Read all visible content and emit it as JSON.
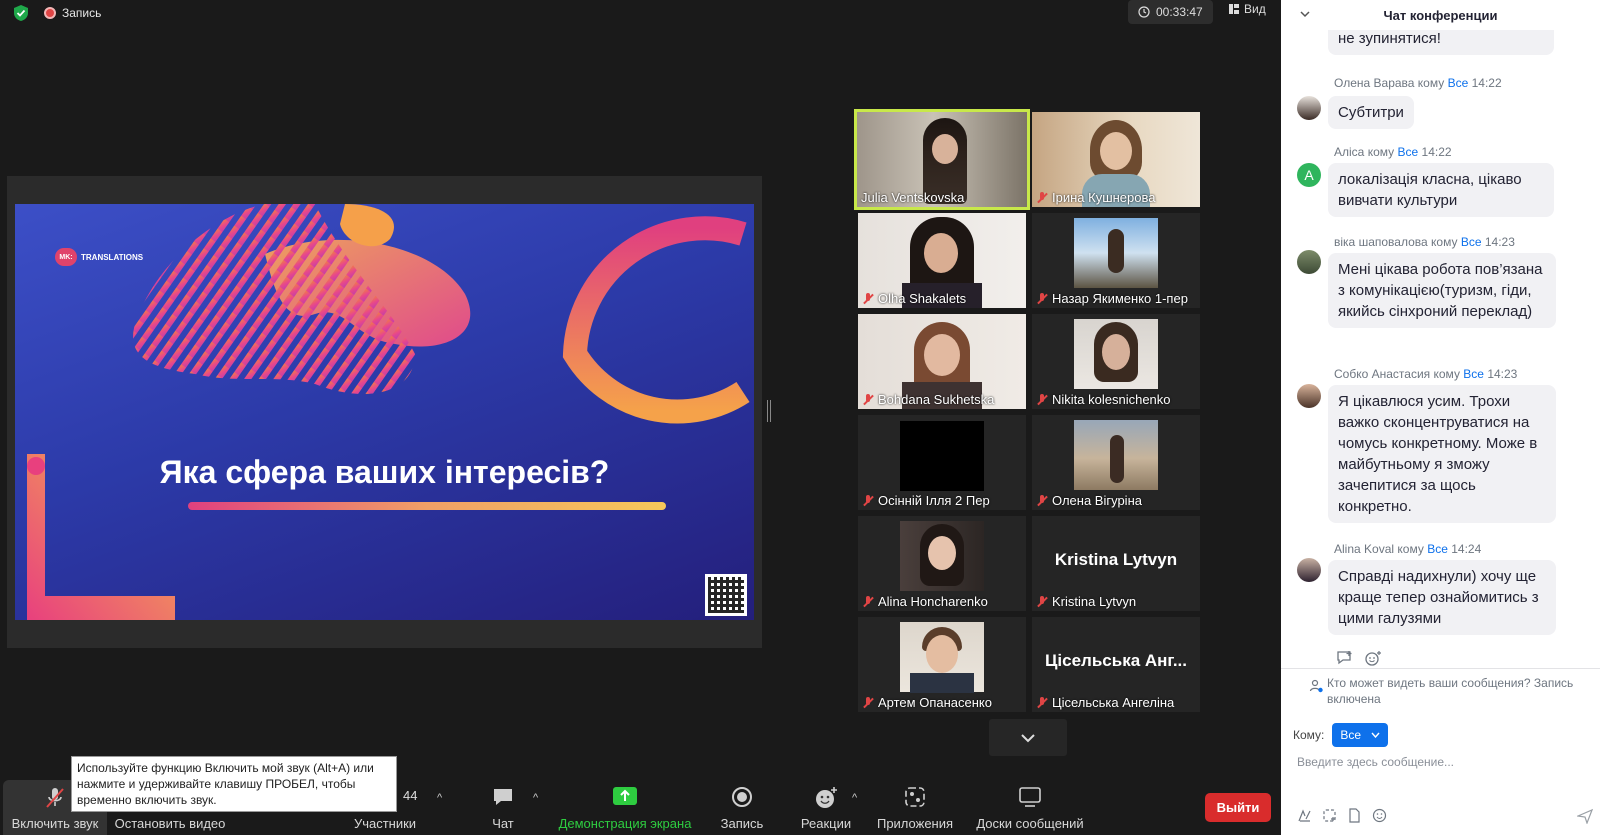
{
  "topbar": {
    "recording_label": "Запись",
    "timer": "00:33:47",
    "view_label": "Вид"
  },
  "slide": {
    "logo_mark": "MK:",
    "logo_text": "TRANSLATIONS",
    "question": "Яка сфера ваших інтересів?"
  },
  "gallery": {
    "tiles": [
      {
        "name": "Julia Ventskovska"
      },
      {
        "name": "Ірина Кушнерова"
      },
      {
        "name": "Olha Shakalets"
      },
      {
        "name": "Назар Якименко 1-пер"
      },
      {
        "name": "Bohdana Sukhetska"
      },
      {
        "name": "Nikita kolesnichenko"
      },
      {
        "name": "Осінній Ілля 2 Пер"
      },
      {
        "name": "Олена Вігуріна"
      },
      {
        "name": "Alina Honcharenko"
      },
      {
        "name": "Kristina Lytvyn",
        "placeholder": "Kristina Lytvyn"
      },
      {
        "name": "Артем Опанасенко"
      },
      {
        "name": "Цісельська Ангеліна",
        "placeholder": "Цісельська Анг..."
      }
    ]
  },
  "tooltip": "Используйте функцию Включить мой звук (Alt+A) или нажмите и удерживайте клавишу ПРОБЕЛ, чтобы временно включить звук.",
  "toolbar": {
    "audio": "Включить звук",
    "video": "Остановить видео",
    "participants": "Участники",
    "participants_count": "44",
    "chat": "Чат",
    "share": "Демонстрация экрана",
    "record": "Запись",
    "reactions": "Реакции",
    "apps": "Приложения",
    "whiteboards": "Доски сообщений",
    "leave": "Выйти"
  },
  "chat": {
    "title": "Чат конференции",
    "to_word": "кому",
    "to_everyone": "Все",
    "top_partial": "не зупинятися!",
    "messages": [
      {
        "sender": "Олена Варава",
        "time": "14:22",
        "text": "Субтитри"
      },
      {
        "sender": "Аліса",
        "time": "14:22",
        "text": "локалізація класна, цікаво вивчати культури",
        "avatar_letter": "A"
      },
      {
        "sender": "віка шаповалова",
        "time": "14:23",
        "text": "Мені цікава робота пов’язана з комунікацією(туризм, гіди, якийсь сінхроний переклад)"
      },
      {
        "sender": "Собко Анастасия",
        "time": "14:23",
        "text": "Я цікавлюся усим. Трохи важко сконцентруватися на чомусь конкретному. Може в майбутньому я зможу зачепитися за щось конкретно."
      },
      {
        "sender": "Alina Koval",
        "time": "14:24",
        "text": "Справді надихнули) хочу ще краще тепер ознайомитись з цими галузями"
      }
    ],
    "privacy_note": "Кто может видеть ваши сообщения? Запись включена",
    "to_label": "Кому:",
    "to_selected": "Все",
    "input_placeholder": "Введите здесь сообщение..."
  },
  "colors": {
    "accent_blue": "#0e71eb",
    "share_green": "#2ecc40",
    "leave_red": "#d92c2c",
    "active_speaker": "#c8e84a",
    "muted_red": "#e04545"
  }
}
